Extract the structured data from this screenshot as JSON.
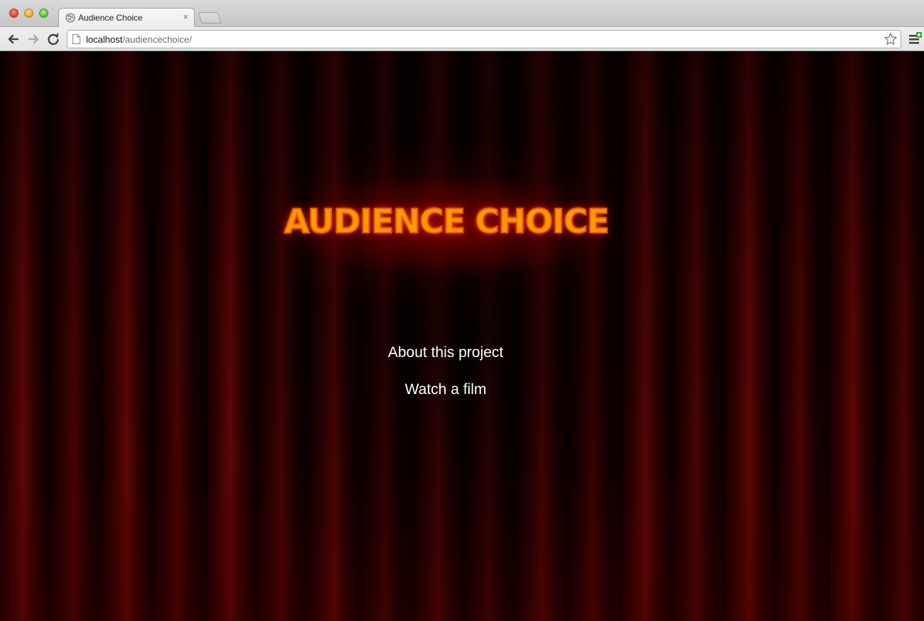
{
  "browser": {
    "tab": {
      "title": "Audience Choice",
      "close_glyph": "×"
    },
    "address_bar": {
      "host": "localhost",
      "path": "/audiencechoice/"
    },
    "icons": {
      "back": "back-arrow-icon",
      "forward": "forward-arrow-icon",
      "reload": "reload-icon",
      "bookmark": "star-icon",
      "menu": "wrench-menu-icon"
    }
  },
  "page": {
    "title": "AUDIENCE CHOICE",
    "links": [
      {
        "label": "About this project"
      },
      {
        "label": "Watch a film"
      }
    ]
  },
  "colors": {
    "title_fill": "#ff9a00",
    "title_outline": "#e85b00",
    "curtain_red": "#5e0606",
    "link_text": "#ffffff"
  }
}
